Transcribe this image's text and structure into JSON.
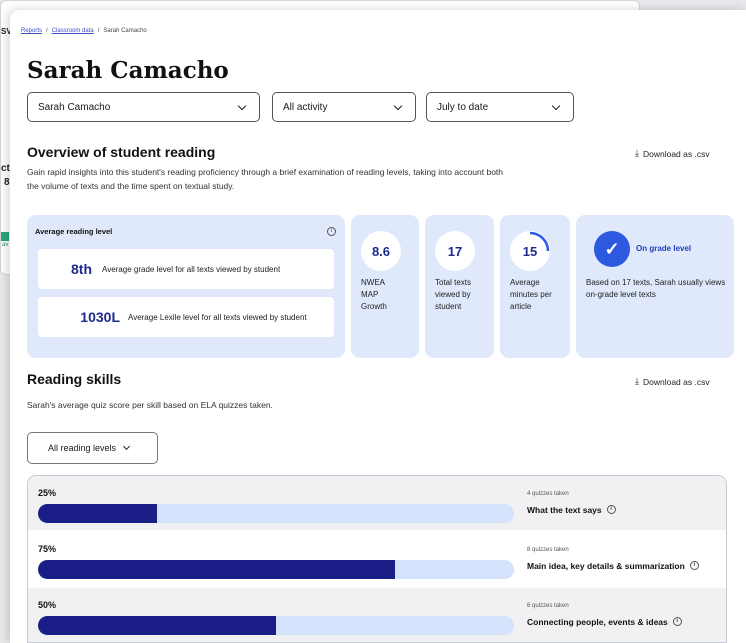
{
  "background": {
    "fragments": [
      "SV",
      "ct",
      "8",
      "av"
    ]
  },
  "breadcrumb": {
    "items": [
      "Reports",
      "Classroom data",
      "Sarah Camacho"
    ],
    "separator": "/"
  },
  "page_title": "Sarah Camacho",
  "filters": {
    "student": "Sarah Camacho",
    "activity": "All activity",
    "period": "July to date"
  },
  "overview": {
    "heading": "Overview of student reading",
    "description_line1": "Gain rapid insights into this student's reading proficiency through a brief examination of reading levels, taking into account both",
    "description_line2": "the volume of texts and the time spent on textual study.",
    "download_label": "Download as .csv",
    "avg_reading_level": {
      "title": "Average reading level",
      "grade_value": "8th",
      "grade_text": "Average grade level for all texts viewed by student",
      "lexile_value": "1030L",
      "lexile_text": "Average Lexile level for all texts viewed by student"
    },
    "stats": [
      {
        "value": "8.6",
        "label_lines": [
          "NWEA",
          "MAP",
          "Growth"
        ]
      },
      {
        "value": "17",
        "label_lines": [
          "Total texts",
          "viewed by",
          "student"
        ]
      },
      {
        "value": "15",
        "label_lines": [
          "Average",
          "minutes per",
          "article"
        ]
      }
    ],
    "grade_status": {
      "title": "On grade level",
      "text": "Based on 17 texts, Sarah usually views on-grade level texts"
    }
  },
  "reading_skills": {
    "heading": "Reading skills",
    "description": "Sarah's average quiz score per skill based on ELA quizzes taken.",
    "download_label": "Download as .csv",
    "level_filter": "All reading levels",
    "skills": [
      {
        "percent_label": "25%",
        "fraction": 0.25,
        "quizzes": "4 quizzes taken",
        "name": "What the text says"
      },
      {
        "percent_label": "75%",
        "fraction": 0.75,
        "quizzes": "8 quizzes taken",
        "name": "Main idea, key details & summarization"
      },
      {
        "percent_label": "50%",
        "fraction": 0.5,
        "quizzes": "6 quizzes taken",
        "name": "Connecting people, events & ideas"
      }
    ]
  },
  "colors": {
    "accent_navy": "#1a1e86",
    "card_bg": "#dfe9fb",
    "bar_track": "#d4e3fb",
    "check_blue": "#2c59e0"
  }
}
